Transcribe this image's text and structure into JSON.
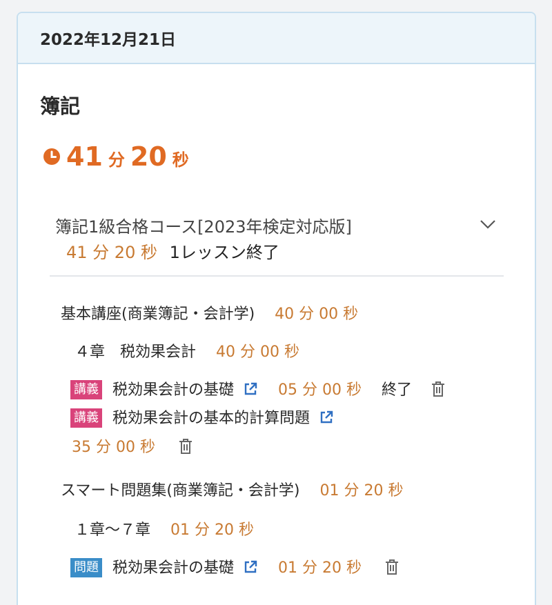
{
  "date": "2022年12月21日",
  "subject": "簿記",
  "total_time": {
    "min": "41",
    "min_unit": "分",
    "sec": "20",
    "sec_unit": "秒"
  },
  "course": {
    "title": "簿記1級合格コース[2023年検定対応版]",
    "time": "41 分 20 秒",
    "lessons_done": "1レッスン終了"
  },
  "sections": [
    {
      "name": "基本講座(商業簿記・会計学)",
      "time": "40 分 00 秒",
      "chapter": "４章　税効果会計",
      "chapter_time": "40 分 00 秒",
      "items": [
        {
          "badge": "講義",
          "title": "税効果会計の基礎",
          "time": "05 分 00 秒",
          "status": "終了"
        },
        {
          "badge": "講義",
          "title": "税効果会計の基本的計算問題",
          "time": "35 分 00 秒",
          "status": ""
        }
      ]
    },
    {
      "name": "スマート問題集(商業簿記・会計学)",
      "time": "01 分 20 秒",
      "chapter": "１章〜７章",
      "chapter_time": "01 分 20 秒",
      "items": [
        {
          "badge": "問題",
          "title": "税効果会計の基礎",
          "time": "01 分 20 秒",
          "status": ""
        }
      ]
    }
  ],
  "colors": {
    "accent": "#e06a23",
    "time": "#c87a32",
    "lecture_badge": "#d9437a",
    "problem_badge": "#3a8dc8",
    "link": "#2f6fc2"
  },
  "icons": {
    "clock": "clock-icon",
    "expand": "chevron-down-icon",
    "external": "external-link-icon",
    "delete": "trash-icon"
  }
}
